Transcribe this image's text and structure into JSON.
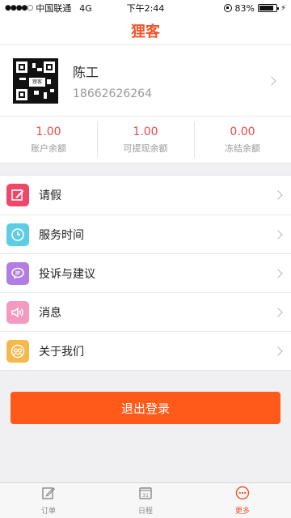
{
  "status_bar": {
    "signal": "●●●●○",
    "carrier": "中国联通",
    "network": "4G",
    "time": "下午2:44",
    "battery_percent": "83%",
    "battery_level": 0.83
  },
  "nav": {
    "title": "狸客"
  },
  "profile": {
    "name": "陈工",
    "phone": "18662626264",
    "qr_logo_text": "狸客"
  },
  "balances": [
    {
      "value": "1.00",
      "label": "账户余额"
    },
    {
      "value": "1.00",
      "label": "可提现余额"
    },
    {
      "value": "0.00",
      "label": "冻结余额"
    }
  ],
  "menu": {
    "items": [
      {
        "label": "请假",
        "icon": "edit-icon",
        "color": "#f0466a"
      },
      {
        "label": "服务时间",
        "icon": "clock-icon",
        "color": "#5ccde5"
      },
      {
        "label": "投诉与建议",
        "icon": "chat-icon",
        "color": "#b17de3"
      },
      {
        "label": "消息",
        "icon": "speaker-icon",
        "color": "#f49ac0"
      },
      {
        "label": "关于我们",
        "icon": "group-icon",
        "color": "#f6b74b"
      }
    ]
  },
  "logout": {
    "label": "退出登录",
    "color": "#ff5a1a"
  },
  "tabs": [
    {
      "label": "订单",
      "icon": "edit-icon"
    },
    {
      "label": "日程",
      "icon": "calendar-icon",
      "calendar_day": "31"
    },
    {
      "label": "更多",
      "icon": "more-icon",
      "active": true
    }
  ],
  "colors": {
    "accent": "#f0542a",
    "balance_value": "#e84b4b"
  }
}
